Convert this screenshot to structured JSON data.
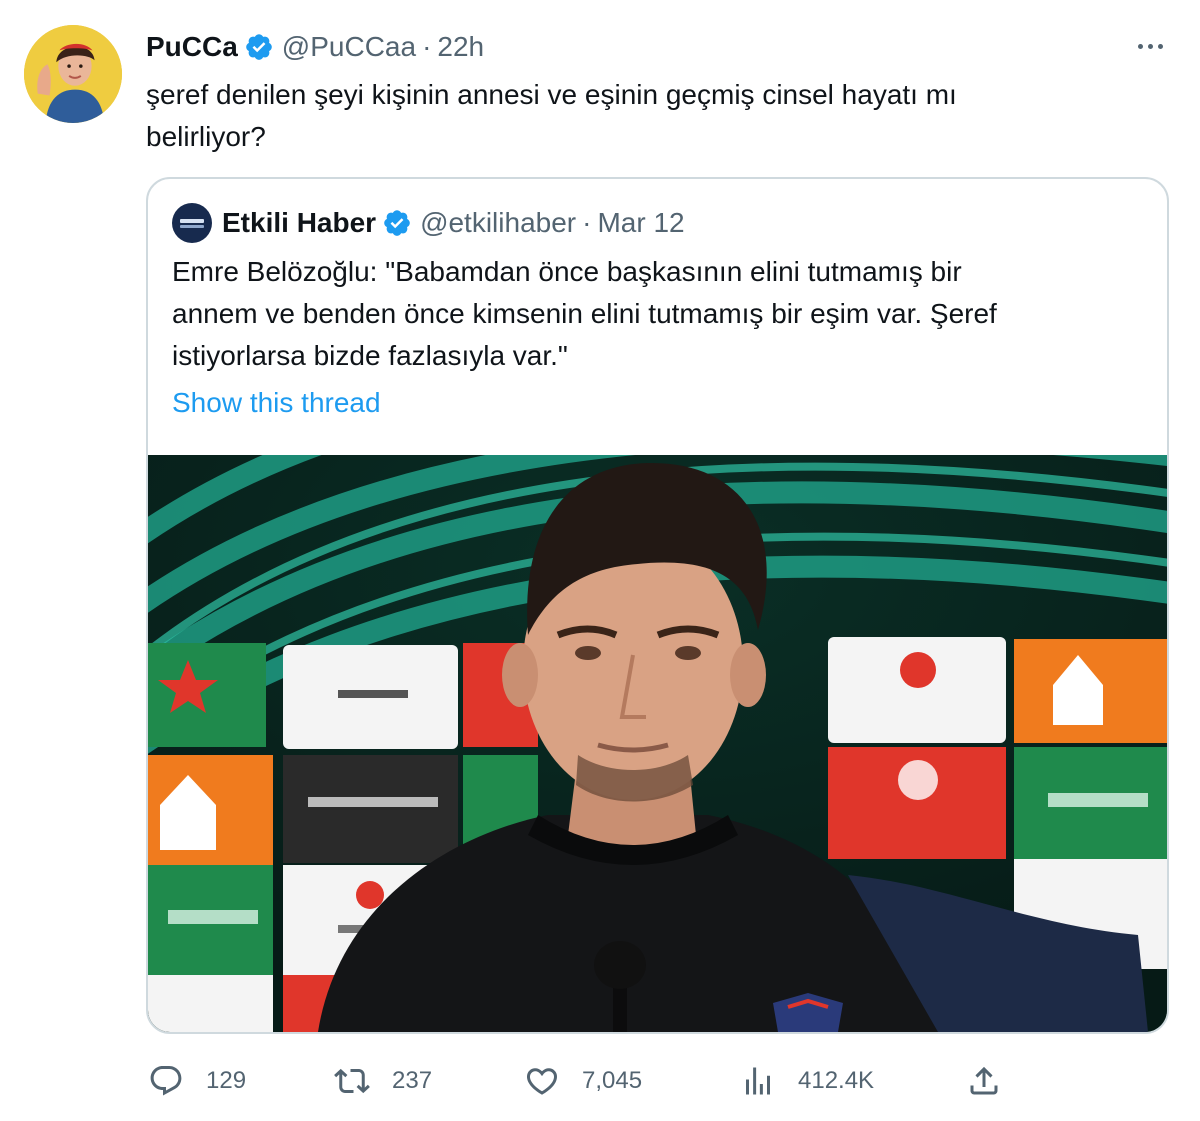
{
  "tweet": {
    "author_name": "PuCCa",
    "handle": "@PuCCaa",
    "separator": "·",
    "time": "22h",
    "text_line1": "şeref denilen şeyi kişinin annesi ve eşinin geçmiş cinsel hayatı mı",
    "text_line2": "belirliyor?",
    "avatar_icon": "avatar-image",
    "verified_icon": "verified-badge-icon",
    "more_icon": "more-options-icon"
  },
  "quote": {
    "author_name": "Etkili Haber",
    "handle": "@etkilihaber",
    "separator": "·",
    "time": "Mar 12",
    "text_line1": "Emre Belözoğlu: \"Babamdan önce başkasının elini tutmamış bir",
    "text_line2": "annem ve benden önce kimsenin elini tutmamış bir eşim var. Şeref",
    "text_line3": "istiyorlarsa bizde fazlasıyla var.\"",
    "thread_link": "Show this thread",
    "photo_description_icon": "press-conference-photo"
  },
  "actions": {
    "replies": "129",
    "retweets": "237",
    "likes": "7,045",
    "views": "412.4K",
    "icons": [
      "reply-icon",
      "retweet-icon",
      "like-icon",
      "views-icon",
      "share-icon"
    ]
  },
  "colors": {
    "link_blue": "#1d9bf0",
    "muted_gray": "#536471",
    "text_dark": "#0f1419",
    "border": "#cfd9de"
  }
}
